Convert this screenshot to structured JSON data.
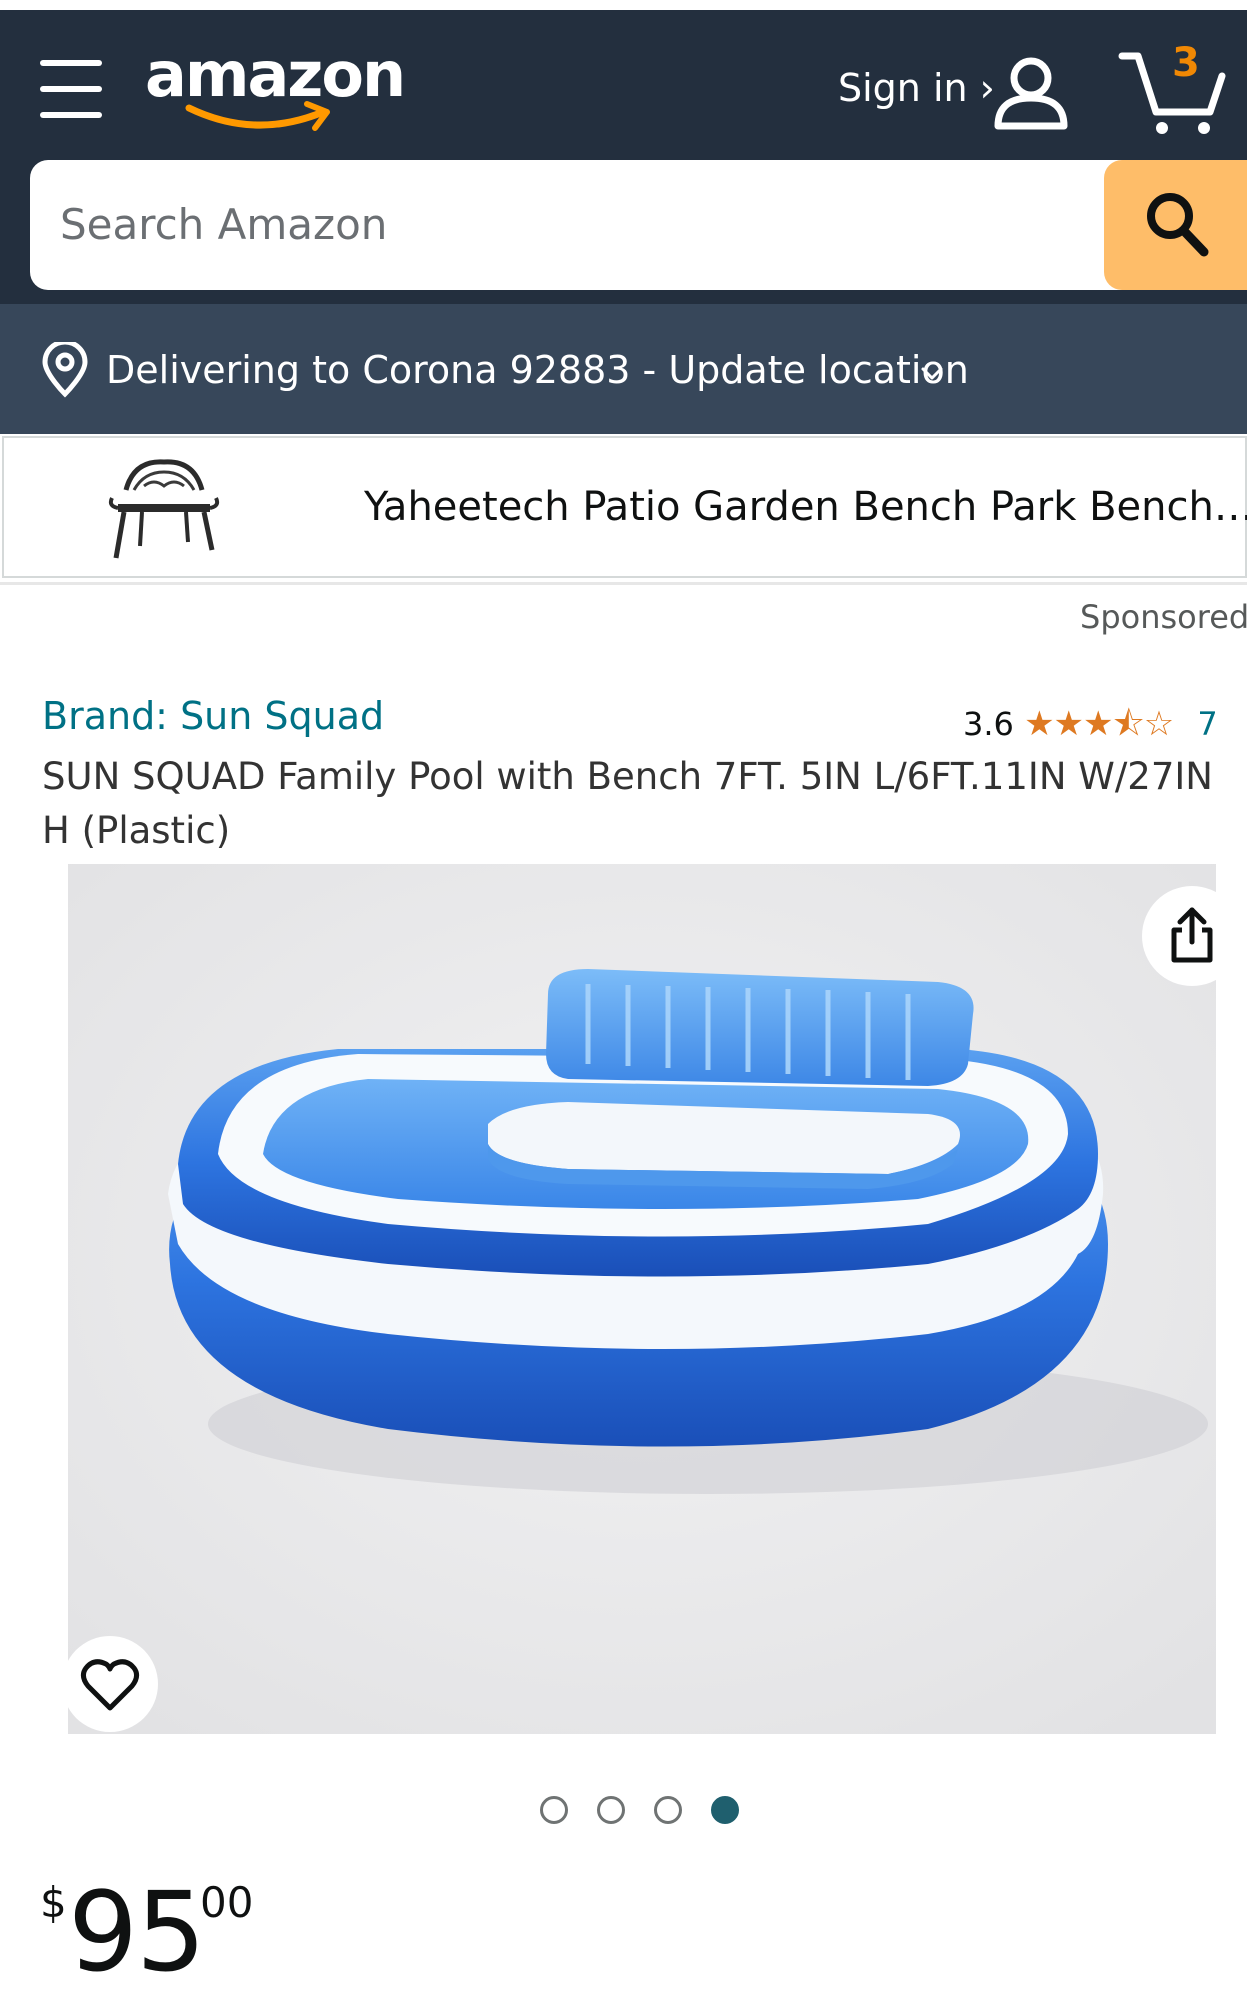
{
  "header": {
    "logo_text": "amazon",
    "signin_label": "Sign in ›",
    "cart_count": "3"
  },
  "search": {
    "placeholder": "Search Amazon"
  },
  "location": {
    "text": "Delivering to Corona 92883 - Update location"
  },
  "banner": {
    "product_name": "Yaheetech Patio Garden Bench Park Bench…",
    "sponsored_label": "Sponsored"
  },
  "product": {
    "brand": "Brand: Sun Squad",
    "rating": "3.6",
    "stars": "★★★⯪☆",
    "rating_value": 3.6,
    "review_count": "7",
    "title": "SUN SQUAD Family Pool with Bench 7FT. 5IN L/6FT.11IN W/27IN H (Plastic)",
    "image_count": 4,
    "active_image": 4
  },
  "price": {
    "symbol": "$",
    "whole": "95",
    "fraction": "00"
  },
  "colors": {
    "header_bg": "#232f3e",
    "location_bg": "#37475a",
    "search_button": "#febd69",
    "link": "#007185",
    "star": "#de7921",
    "cart_count": "#f08804"
  }
}
